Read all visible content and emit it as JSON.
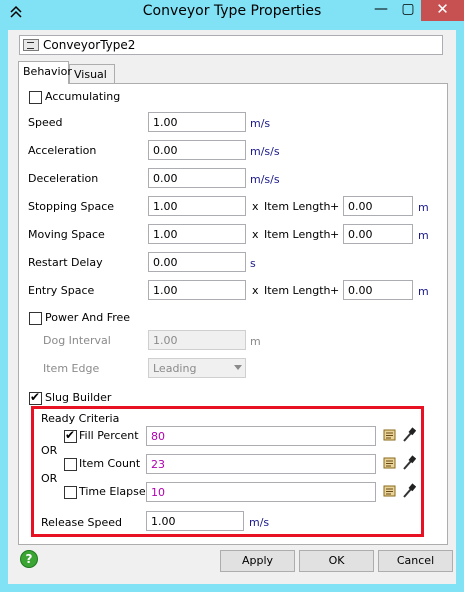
{
  "window": {
    "title": "Conveyor Type Properties",
    "close_glyph": "✕",
    "minimize_glyph": "—",
    "maximize_glyph": "▢"
  },
  "name_field": {
    "value": "ConveyorType2"
  },
  "tabs": [
    {
      "label": "Behavior",
      "active": true
    },
    {
      "label": "Visual",
      "active": false
    }
  ],
  "behavior": {
    "accumulating": {
      "label": "Accumulating",
      "checked": false
    },
    "speed": {
      "label": "Speed",
      "value": "1.00",
      "unit": "m/s"
    },
    "acceleration": {
      "label": "Acceleration",
      "value": "0.00",
      "unit": "m/s/s"
    },
    "deceleration": {
      "label": "Deceleration",
      "value": "0.00",
      "unit": "m/s/s"
    },
    "stopping_space": {
      "label": "Stopping Space",
      "value": "1.00",
      "mult": "x",
      "item_length_label": "Item Length",
      "plus": "+",
      "offset_value": "0.00",
      "unit": "m"
    },
    "moving_space": {
      "label": "Moving Space",
      "value": "1.00",
      "mult": "x",
      "item_length_label": "Item Length",
      "plus": "+",
      "offset_value": "0.00",
      "unit": "m"
    },
    "restart_delay": {
      "label": "Restart Delay",
      "value": "0.00",
      "unit": "s"
    },
    "entry_space": {
      "label": "Entry Space",
      "value": "1.00",
      "mult": "x",
      "item_length_label": "Item Length",
      "plus": "+",
      "offset_value": "0.00",
      "unit": "m"
    },
    "power_and_free": {
      "label": "Power And Free",
      "checked": false
    },
    "dog_interval": {
      "label": "Dog Interval",
      "value": "1.00",
      "unit": "m"
    },
    "item_edge": {
      "label": "Item Edge",
      "value": "Leading"
    },
    "slug_builder": {
      "label": "Slug Builder",
      "checked": true
    },
    "ready_criteria": {
      "label": "Ready Criteria",
      "fill_percent": {
        "label": "Fill Percent",
        "checked": true,
        "value": "80"
      },
      "or_1": "OR",
      "item_count": {
        "label": "Item Count",
        "checked": false,
        "value": "23"
      },
      "or_2": "OR",
      "time_elapsed": {
        "label": "Time Elapsed",
        "checked": false,
        "value": "10"
      }
    },
    "release_speed": {
      "label": "Release Speed",
      "value": "1.00",
      "unit": "m/s"
    }
  },
  "footer": {
    "help_label": "?",
    "apply_label": "Apply",
    "ok_label": "OK",
    "cancel_label": "Cancel"
  },
  "colors": {
    "title_bar": "#81e2f6",
    "highlight_box": "#e81123",
    "value_text": "#b000b0",
    "close_button": "#c75050"
  },
  "icons": [
    "chevrons-up-icon",
    "name-field-icon",
    "script-icon",
    "eyedropper-icon",
    "help-icon"
  ]
}
